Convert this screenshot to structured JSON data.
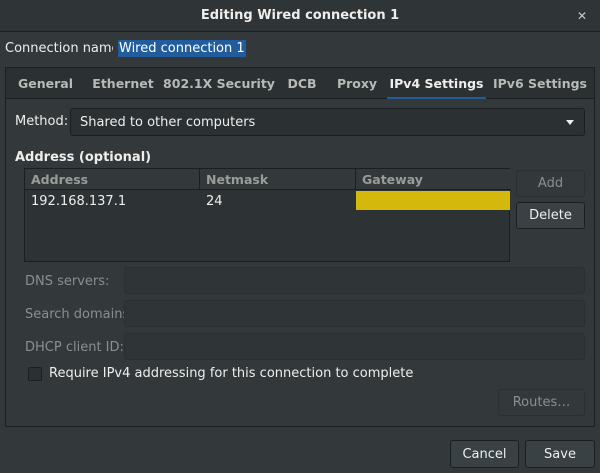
{
  "window": {
    "title": "Editing Wired connection 1",
    "close_icon": "close-icon"
  },
  "connection": {
    "label": "Connection name:",
    "value": "Wired connection 1"
  },
  "tabs": [
    {
      "label": "General",
      "active": false
    },
    {
      "label": "Ethernet",
      "active": false
    },
    {
      "label": "802.1X Security",
      "active": false
    },
    {
      "label": "DCB",
      "active": false
    },
    {
      "label": "Proxy",
      "active": false
    },
    {
      "label": "IPv4 Settings",
      "active": true
    },
    {
      "label": "IPv6 Settings",
      "active": false
    }
  ],
  "method": {
    "label": "Method:",
    "value": "Shared to other computers"
  },
  "address": {
    "heading": "Address (optional)",
    "columns": [
      "Address",
      "Netmask",
      "Gateway"
    ],
    "rows": [
      {
        "address": "192.168.137.1",
        "netmask": "24",
        "gateway": ""
      }
    ],
    "add_label": "Add",
    "delete_label": "Delete"
  },
  "fields": {
    "dns_label": "DNS servers:",
    "search_label": "Search domains:",
    "dhcp_label": "DHCP client ID:"
  },
  "require_label": "Require IPv4 addressing for this connection to complete",
  "routes_label": "Routes…",
  "buttons": {
    "cancel": "Cancel",
    "save": "Save"
  },
  "colors": {
    "selection": "#215d9c",
    "gateway_highlight": "#d4b90c",
    "background": "#33393b"
  }
}
